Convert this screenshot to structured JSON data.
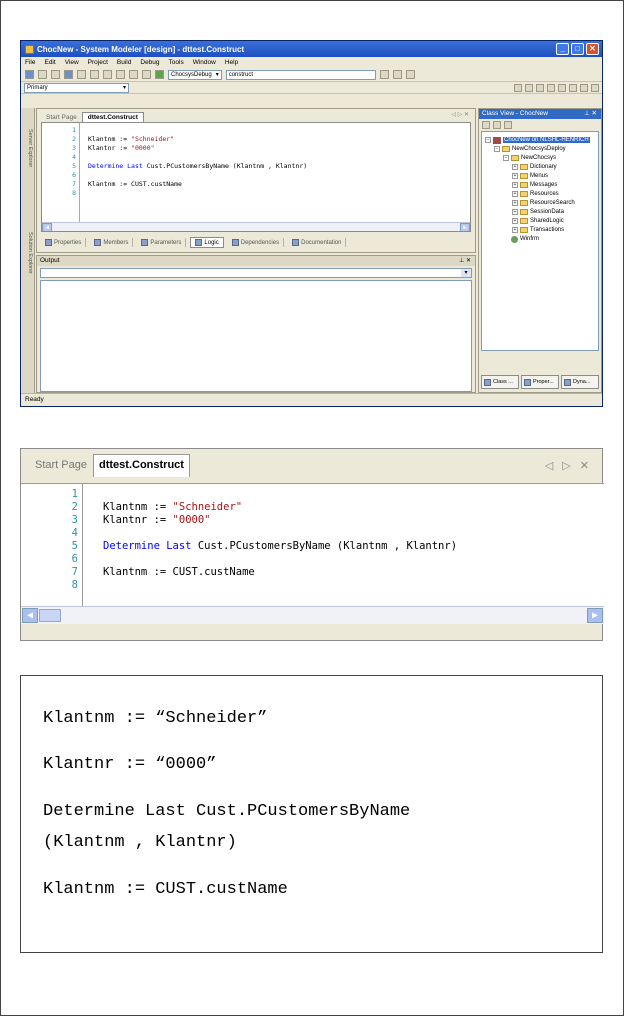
{
  "ide": {
    "window_title": "ChocNew - System Modeler [design] - dttest.Construct",
    "menu": [
      "File",
      "Edit",
      "View",
      "Project",
      "Build",
      "Debug",
      "Tools",
      "Window",
      "Help"
    ],
    "toolbar": {
      "config_combo": "ChocsysDebug",
      "find_combo": "construct",
      "primary_combo": "Primary"
    },
    "left_strip_tabs": [
      "Server Explorer",
      "Solution Explorer"
    ],
    "doc_tabs": [
      "Start Page",
      "dttest.Construct"
    ],
    "code_lines": [
      {
        "ln": "1",
        "parts": []
      },
      {
        "ln": "2",
        "parts": [
          {
            "t": "Klantnm := ",
            "c": ""
          },
          {
            "t": "\"Schneider\"",
            "c": "str"
          }
        ]
      },
      {
        "ln": "3",
        "parts": [
          {
            "t": "Klantnr := ",
            "c": ""
          },
          {
            "t": "\"0000\"",
            "c": "str"
          }
        ]
      },
      {
        "ln": "4",
        "parts": []
      },
      {
        "ln": "5",
        "parts": [
          {
            "t": "Determine Last",
            "c": "kw"
          },
          {
            "t": " Cust.PCustomersByName (Klantnm , Klantnr)",
            "c": ""
          }
        ]
      },
      {
        "ln": "6",
        "parts": []
      },
      {
        "ln": "7",
        "parts": [
          {
            "t": "Klantnm := CUST.custName",
            "c": ""
          }
        ]
      },
      {
        "ln": "8",
        "parts": []
      }
    ],
    "bottom_tabs": [
      "Properties",
      "Members",
      "Parameters",
      "Logic",
      "Dependencies",
      "Documentation"
    ],
    "active_bottom_tab": "Logic",
    "output_title": "Output",
    "class_view": {
      "title": "Class View - ChocNew",
      "tree": [
        {
          "label": "ChocNew on NLSHL-HENRICH",
          "level": 0,
          "kind": "proj",
          "selected": true
        },
        {
          "label": "NewChocsysDeploy",
          "level": 1,
          "kind": "folder"
        },
        {
          "label": "NewChocsys",
          "level": 2,
          "kind": "folder"
        },
        {
          "label": "Dictionary",
          "level": 3,
          "kind": "folder"
        },
        {
          "label": "Menus",
          "level": 3,
          "kind": "folder"
        },
        {
          "label": "Messages",
          "level": 3,
          "kind": "folder"
        },
        {
          "label": "Resources",
          "level": 3,
          "kind": "folder"
        },
        {
          "label": "ResourceSearch",
          "level": 3,
          "kind": "folder"
        },
        {
          "label": "SessionData",
          "level": 3,
          "kind": "folder"
        },
        {
          "label": "SharedLogic",
          "level": 3,
          "kind": "folder"
        },
        {
          "label": "Transactions",
          "level": 3,
          "kind": "folder"
        },
        {
          "label": "Winfrm",
          "level": 2,
          "kind": "gear"
        }
      ],
      "bottom_tabs": [
        "Class ...",
        "Proper...",
        "Dyna..."
      ]
    },
    "status": "Ready"
  },
  "zoom": {
    "tabs": [
      "Start Page",
      "dttest.Construct"
    ],
    "nav": "◁ ▷ ✕"
  },
  "listing": {
    "lines": [
      "Klantnm := “Schneider”",
      "Klantnr := “0000”",
      "Determine Last Cust.PCustomersByName",
      "(Klantnm , Klantnr)",
      "Klantnm := CUST.custName"
    ]
  }
}
